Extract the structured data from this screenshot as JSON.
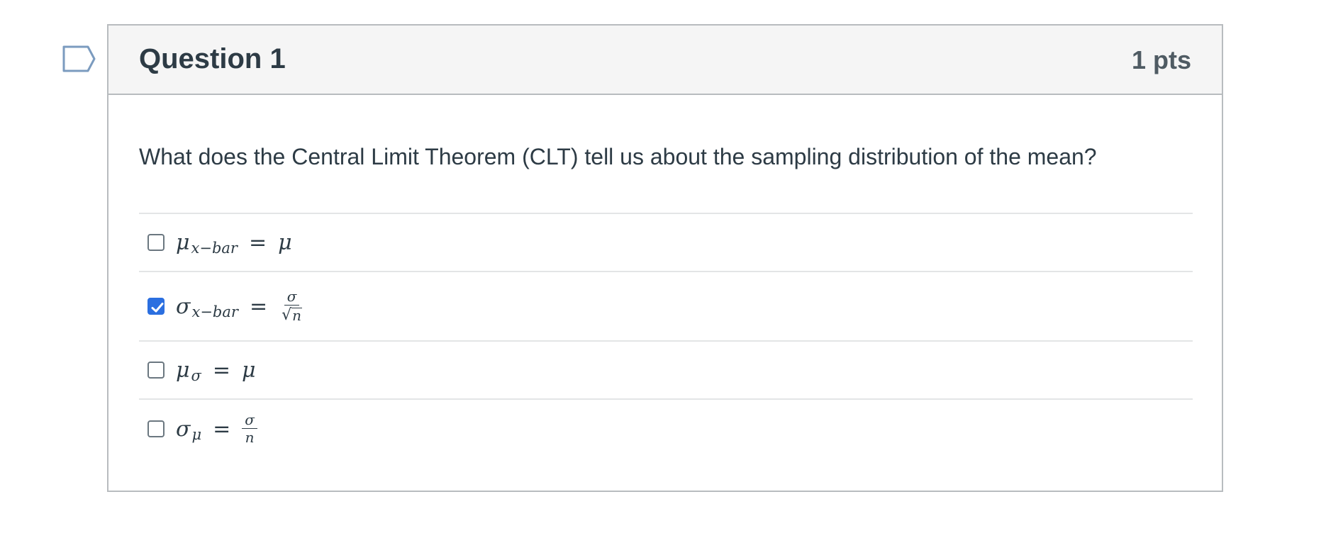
{
  "question": {
    "title": "Question 1",
    "points": "1 pts",
    "text": "What does the Central Limit Theorem (CLT) tell us about the sampling distribution of the mean?"
  },
  "answers": [
    {
      "checked": false,
      "lhs": "μ",
      "lhs_sub": "x−bar",
      "eq": "=",
      "rhs": "μ"
    },
    {
      "checked": true,
      "lhs": "σ",
      "lhs_sub": "x−bar",
      "eq": "=",
      "rhs_num": "σ",
      "rhs_den_sqrt": "√",
      "rhs_den": "n"
    },
    {
      "checked": false,
      "lhs": "μ",
      "lhs_sub": "σ",
      "eq": "=",
      "rhs": "μ"
    },
    {
      "checked": false,
      "lhs": "σ",
      "lhs_sub": "μ",
      "eq": "=",
      "rhs_num": "σ",
      "rhs_den": "n"
    }
  ],
  "icons": {
    "flag": "bookmark-flag-icon",
    "check": "checkmark-icon"
  },
  "colors": {
    "accent": "#2b6fe0",
    "flag": "#7b9bbf",
    "text": "#2d3b45",
    "header_bg": "#f5f5f5",
    "border": "#b8bcbf"
  }
}
